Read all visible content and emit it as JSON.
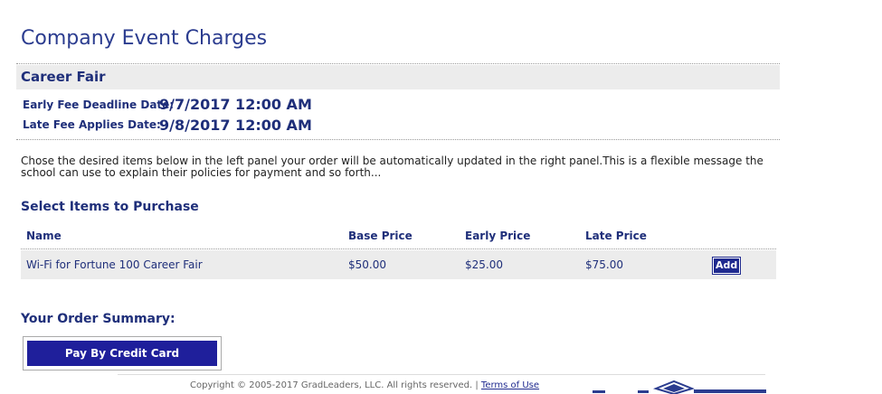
{
  "page": {
    "title": "Company Event Charges"
  },
  "event": {
    "name": "Career Fair",
    "early_label": "Early Fee Deadline Date:",
    "early_value": "9/7/2017 12:00 AM",
    "late_label": "Late Fee Applies Date:",
    "late_value": "9/8/2017 12:00 AM"
  },
  "message": "Chose the desired items below in the left panel your order will be automatically updated in the right panel.This is a flexible message the school can use to explain their policies for payment and so forth...",
  "items_section": {
    "heading": "Select Items to Purchase",
    "columns": {
      "name": "Name",
      "base": "Base Price",
      "early": "Early Price",
      "late": "Late Price"
    },
    "rows": [
      {
        "name": "Wi-Fi for Fortune 100 Career Fair",
        "base": "$50.00",
        "early": "$25.00",
        "late": "$75.00",
        "action": "Add"
      }
    ]
  },
  "summary": {
    "heading": "Your Order Summary:",
    "pay_button": "Pay By Credit Card"
  },
  "footer": {
    "copyright": "Copyright © 2005-2017 GradLeaders, LLC. All rights reserved.",
    "separator": "|",
    "terms_link": "Terms of Use"
  },
  "colors": {
    "brand": "#1f2f7a",
    "button": "#1f1f9b",
    "row_bg": "#ececec"
  }
}
